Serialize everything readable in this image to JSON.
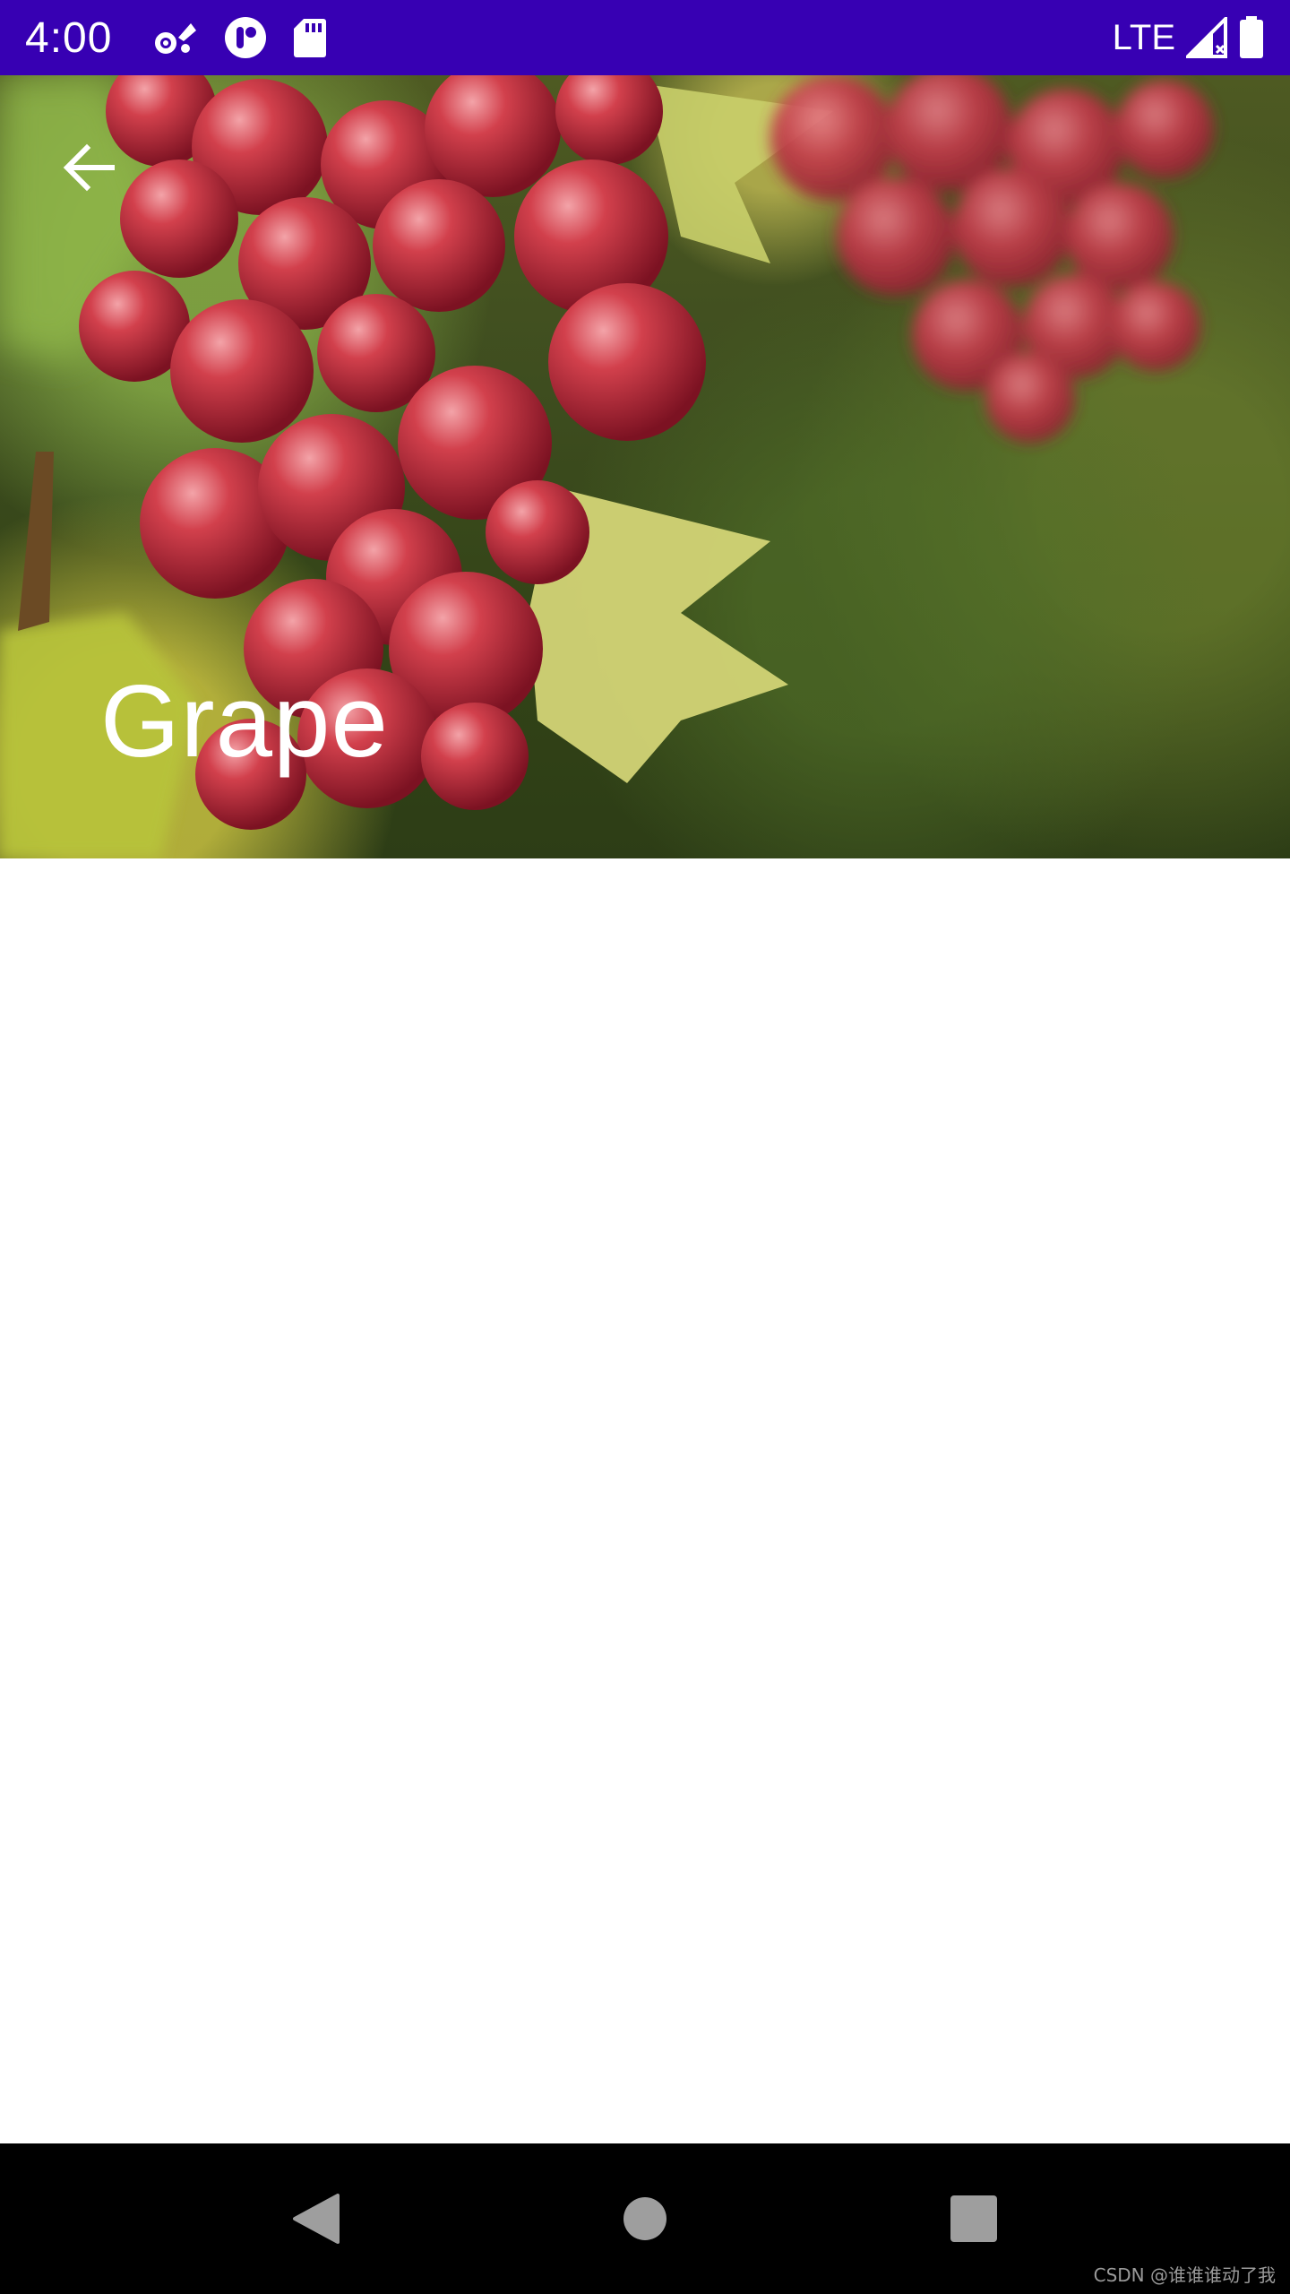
{
  "status_bar": {
    "time": "4:00",
    "network": "LTE",
    "icons": [
      "settings-icon",
      "media-icon",
      "sd-card-icon",
      "signal-icon",
      "battery-icon"
    ],
    "background": "#3700b3"
  },
  "header": {
    "title": "Grape",
    "back_icon": "arrow-back-icon"
  },
  "nav_bar": {
    "buttons": [
      "back-triangle-icon",
      "home-circle-icon",
      "recents-square-icon"
    ]
  },
  "watermark": "CSDN @谁谁谁动了我"
}
